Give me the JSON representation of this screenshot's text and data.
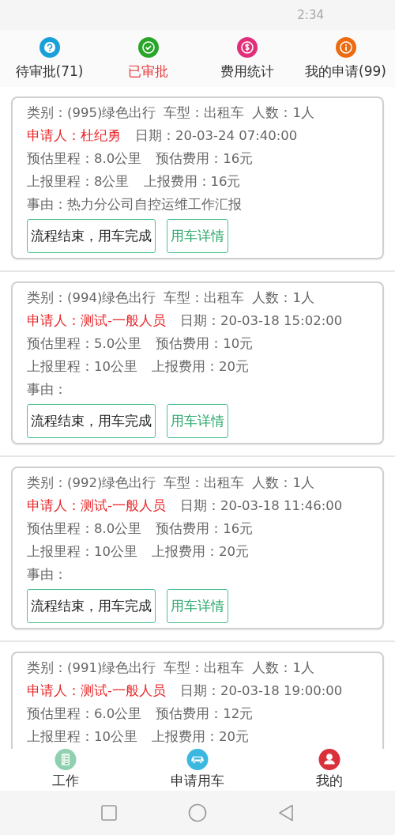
{
  "status_bar": {
    "time": "2:34"
  },
  "tabs": [
    {
      "label": "待审批(71)",
      "color": "#1aa0d8",
      "selected": false
    },
    {
      "label": "已审批",
      "color": "#2aa52a",
      "selected": true
    },
    {
      "label": "费用统计",
      "color": "#e0307a",
      "selected": false
    },
    {
      "label": "我的申请(99)",
      "color": "#ec6a10",
      "selected": false
    }
  ],
  "records": [
    {
      "category": "类别：(995)绿色出行",
      "vehicle": "车型：出租车",
      "people": "人数：1人",
      "applicant": "申请人：杜纪勇",
      "date": "日期：20-03-24 07:40:00",
      "est_distance": "预估里程：8.0公里",
      "est_cost": "预估费用：16元",
      "rep_distance": "上报里程：8公里",
      "rep_cost": "上报费用：16元",
      "reason": "事由：热力分公司自控运维工作汇报",
      "status_button": "流程结束，用车完成",
      "details_button": "用车详情"
    },
    {
      "category": "类别：(994)绿色出行",
      "vehicle": "车型：出租车",
      "people": "人数：1人",
      "applicant": "申请人：测试-一般人员",
      "date": "日期：20-03-18 15:02:00",
      "est_distance": "预估里程：5.0公里",
      "est_cost": "预估费用：10元",
      "rep_distance": "上报里程：10公里",
      "rep_cost": "上报费用：20元",
      "reason": "事由：",
      "status_button": "流程结束，用车完成",
      "details_button": "用车详情"
    },
    {
      "category": "类别：(992)绿色出行",
      "vehicle": "车型：出租车",
      "people": "人数：1人",
      "applicant": "申请人：测试-一般人员",
      "date": "日期：20-03-18 11:46:00",
      "est_distance": "预估里程：8.0公里",
      "est_cost": "预估费用：16元",
      "rep_distance": "上报里程：10公里",
      "rep_cost": "上报费用：20元",
      "reason": "事由：",
      "status_button": "流程结束，用车完成",
      "details_button": "用车详情"
    },
    {
      "category": "类别：(991)绿色出行",
      "vehicle": "车型：出租车",
      "people": "人数：1人",
      "applicant": "申请人：测试-一般人员",
      "date": "日期：20-03-18 19:00:00",
      "est_distance": "预估里程：6.0公里",
      "est_cost": "预估费用：12元",
      "rep_distance": "上报里程：10公里",
      "rep_cost": "上报费用：20元"
    }
  ],
  "bottom_nav": [
    {
      "label": "工作"
    },
    {
      "label": "申请用车"
    },
    {
      "label": "我的"
    }
  ]
}
